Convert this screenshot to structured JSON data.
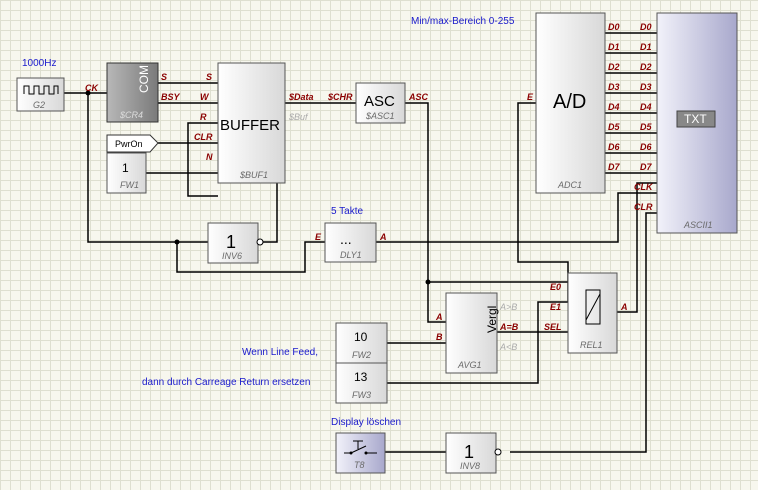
{
  "labels": {
    "freq": "1000Hz",
    "range": "Min/max-Bereich 0-255",
    "takte": "5 Takte",
    "linefeed": "Wenn Line Feed,",
    "carriage": "dann durch Carreage Return ersetzen",
    "clear": "Display löschen"
  },
  "blocks": {
    "g2": {
      "name": "G2"
    },
    "com": {
      "title": "COM",
      "name": "$CR4",
      "pins": [
        "CK",
        "S",
        "BSY"
      ]
    },
    "buffer": {
      "title": "BUFFER",
      "name": "$BUF1",
      "pins_in": [
        "S",
        "W",
        "R",
        "CLR",
        "N"
      ],
      "pins_out": [
        "$Data",
        "$Buf"
      ]
    },
    "pwron": {
      "title": "PwrOn"
    },
    "fw1": {
      "value": "1",
      "name": "FW1"
    },
    "asc": {
      "title": "ASC",
      "name": "$ASC1",
      "pin_in": "$CHR",
      "pin_out": "ASC"
    },
    "inv6": {
      "value": "1",
      "name": "INV6"
    },
    "dly1": {
      "title": "...",
      "name": "DLY1",
      "pin_in": "E",
      "pin_out": "A"
    },
    "adc": {
      "title": "A/D",
      "name": "ADC1",
      "pin_in": "E",
      "outputs": [
        "D0",
        "D1",
        "D2",
        "D3",
        "D4",
        "D5",
        "D6",
        "D7"
      ]
    },
    "ascii": {
      "title": "TXT",
      "name": "ASCII1",
      "inputs": [
        "D0",
        "D1",
        "D2",
        "D3",
        "D4",
        "D5",
        "D6",
        "D7"
      ],
      "clk": "CLK",
      "clr": "CLR"
    },
    "avg1": {
      "title": "Vergl",
      "name": "AVG1",
      "pins_in": [
        "A",
        "B"
      ],
      "pins_out": [
        "A>B",
        "A=B",
        "A<B"
      ]
    },
    "rel1": {
      "name": "REL1",
      "pins_in": [
        "E0",
        "E1",
        "SEL"
      ],
      "pin_out": "A"
    },
    "fw2": {
      "value": "10",
      "name": "FW2"
    },
    "fw3": {
      "value": "13",
      "name": "FW3"
    },
    "t8": {
      "name": "T8"
    },
    "inv8": {
      "value": "1",
      "name": "INV8"
    }
  },
  "colors": {
    "label_blue": "#1a1acc",
    "pin_red": "#8b0000",
    "block_fill": "#f0f0f0"
  }
}
